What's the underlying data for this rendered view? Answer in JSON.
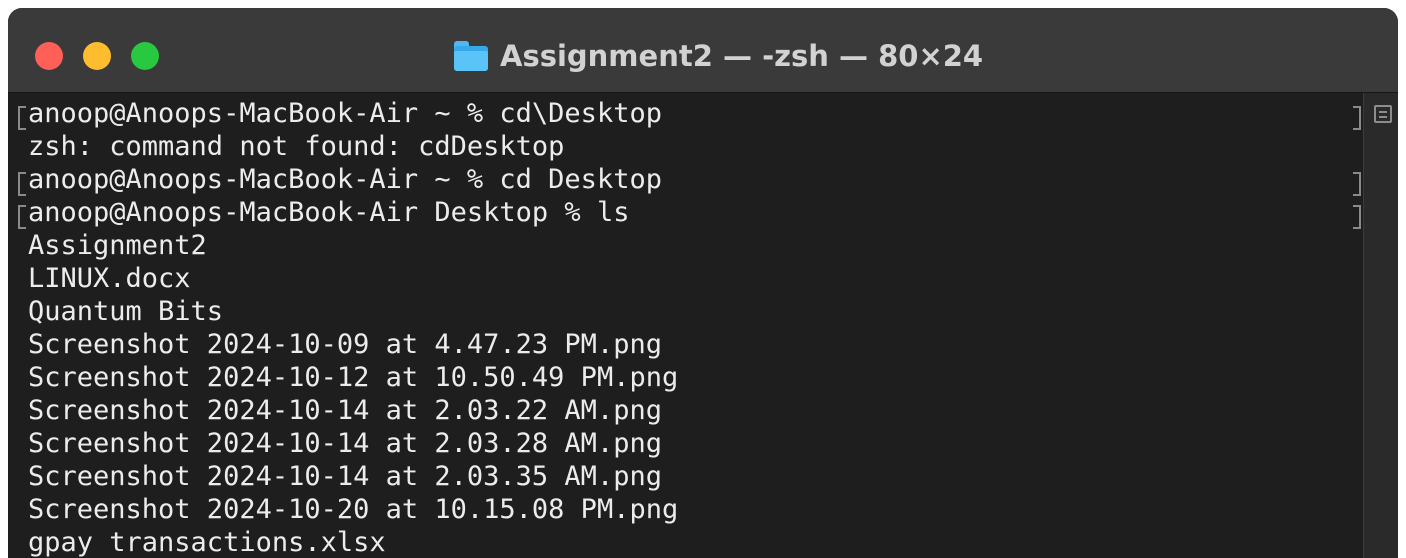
{
  "window": {
    "title": "Assignment2 — -zsh — 80×24",
    "icon": "folder-icon"
  },
  "terminal": {
    "lines": [
      "anoop@Anoops-MacBook-Air ~ % cd\\Desktop",
      "zsh: command not found: cdDesktop",
      "anoop@Anoops-MacBook-Air ~ % cd Desktop",
      "anoop@Anoops-MacBook-Air Desktop % ls",
      "Assignment2",
      "LINUX.docx",
      "Quantum Bits",
      "Screenshot 2024-10-09 at 4.47.23 PM.png",
      "Screenshot 2024-10-12 at 10.50.49 PM.png",
      "Screenshot 2024-10-14 at 2.03.22 AM.png",
      "Screenshot 2024-10-14 at 2.03.28 AM.png",
      "Screenshot 2024-10-14 at 2.03.35 AM.png",
      "Screenshot 2024-10-20 at 10.15.08 PM.png",
      "gpay transactions.xlsx"
    ]
  },
  "colors": {
    "close": "#fe5f57",
    "minimize": "#febc2e",
    "zoom": "#28c840",
    "background": "#1e1e1e",
    "text": "#ececec"
  }
}
